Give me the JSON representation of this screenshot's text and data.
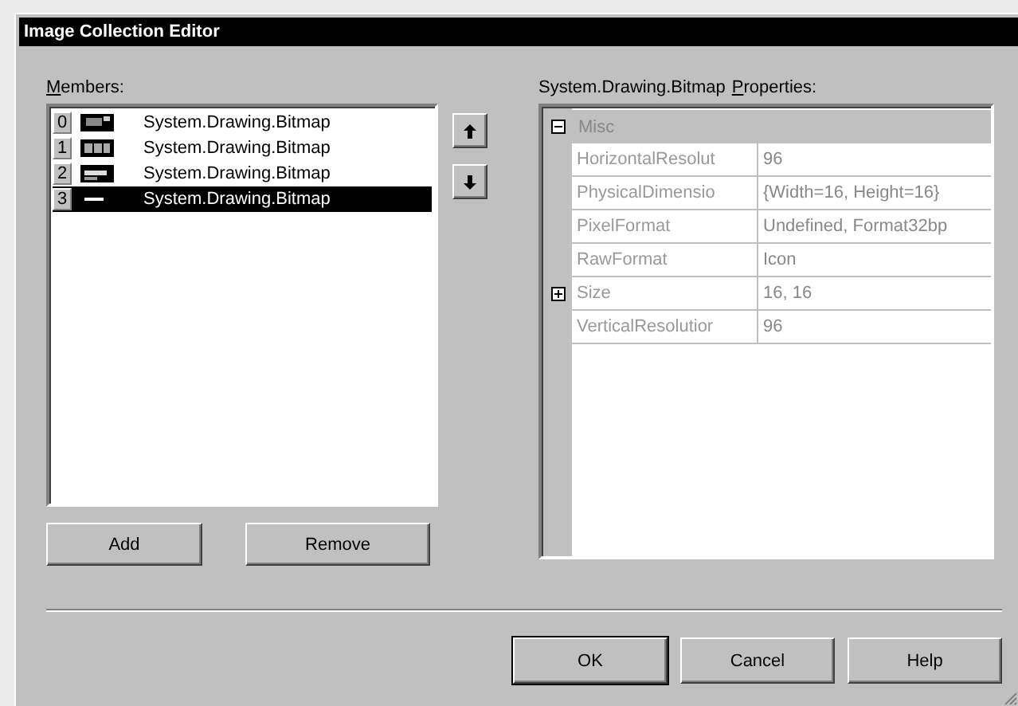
{
  "window": {
    "title": "Image Collection Editor"
  },
  "members": {
    "label": "Members:",
    "items": [
      {
        "index": "0",
        "name": "System.Drawing.Bitmap",
        "selected": false
      },
      {
        "index": "1",
        "name": "System.Drawing.Bitmap",
        "selected": false
      },
      {
        "index": "2",
        "name": "System.Drawing.Bitmap",
        "selected": false
      },
      {
        "index": "3",
        "name": "System.Drawing.Bitmap",
        "selected": true
      }
    ],
    "buttons": [
      "Add",
      "Remove"
    ]
  },
  "properties": {
    "object": "System.Drawing.Bitmap",
    "label": "Properties:",
    "rows": [
      {
        "kind": "category",
        "name": "Misc",
        "expanded": true
      },
      {
        "kind": "property",
        "name": "HorizontalResolut",
        "value": "96"
      },
      {
        "kind": "property",
        "name": "PhysicalDimensio",
        "value": "{Width=16, Height=16}"
      },
      {
        "kind": "property",
        "name": "PixelFormat",
        "value": "Undefined, Format32bp"
      },
      {
        "kind": "property",
        "name": "RawFormat",
        "value": "Icon"
      },
      {
        "kind": "group",
        "name": "Size",
        "value": "16, 16",
        "expanded": false
      },
      {
        "kind": "property",
        "name": "VerticalResolutior",
        "value": "96"
      }
    ]
  },
  "buttons": [
    "OK",
    "Cancel",
    "Help"
  ]
}
